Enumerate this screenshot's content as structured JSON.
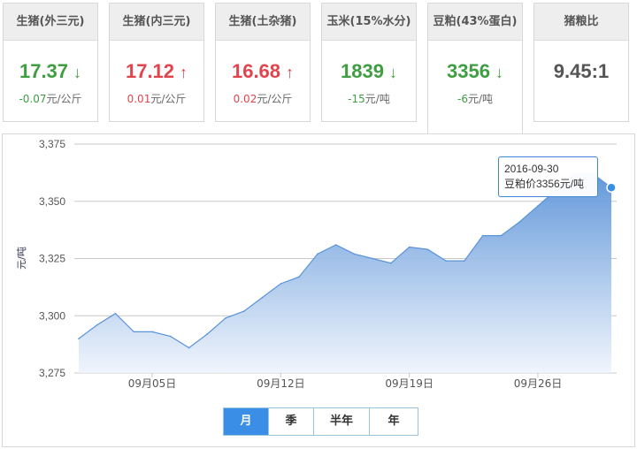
{
  "cards": [
    {
      "title": "生猪(外三元)",
      "price": "17.37",
      "arrow": "↓",
      "trend": "down",
      "change": "-0.07",
      "unit": "元/公斤"
    },
    {
      "title": "生猪(内三元)",
      "price": "17.12",
      "arrow": "↑",
      "trend": "up",
      "change": "0.01",
      "unit": "元/公斤"
    },
    {
      "title": "生猪(土杂猪)",
      "price": "16.68",
      "arrow": "↑",
      "trend": "up",
      "change": "0.02",
      "unit": "元/公斤"
    },
    {
      "title": "玉米(15%水分)",
      "price": "1839",
      "arrow": "↓",
      "trend": "down",
      "change": "-15",
      "unit": "元/吨"
    },
    {
      "title": "豆粕(43%蛋白)",
      "price": "3356",
      "arrow": "↓",
      "trend": "down",
      "change": "-6",
      "unit": "元/吨"
    },
    {
      "title": "猪粮比",
      "price": "9.45:1"
    }
  ],
  "active_card": "豆粕(43%蛋白)",
  "tabs": [
    "月",
    "季",
    "半年",
    "年"
  ],
  "active_tab": "月",
  "tooltip": {
    "date": "2016-09-30",
    "label": "豆粕价3356元/吨"
  },
  "colors": {
    "line": "#5b93d8",
    "area_top": "#5b93d8",
    "area_bottom": "#eef4fc",
    "point": "#3a8ee6",
    "grid": "#c8c8c8",
    "down": "#3f9d42",
    "up": "#e1444d"
  },
  "chart_data": {
    "type": "area",
    "ylabel": "元/吨",
    "ylim": [
      3275,
      3375
    ],
    "yticks": [
      "3,275",
      "3,300",
      "3,325",
      "3,350",
      "3,375"
    ],
    "yticks_values": [
      3275,
      3300,
      3325,
      3350,
      3375
    ],
    "xlim": [
      "2016-09-01",
      "2016-09-30"
    ],
    "xticks": [
      "09月05日",
      "09月12日",
      "09月19日",
      "09月26日"
    ],
    "xticks_dates": [
      "2016-09-05",
      "2016-09-12",
      "2016-09-19",
      "2016-09-26"
    ],
    "grid": true,
    "legend": false,
    "series": [
      {
        "points": [
          {
            "x": "2016-09-01",
            "y": 3290
          },
          {
            "x": "2016-09-02",
            "y": 3296
          },
          {
            "x": "2016-09-03",
            "y": 3301
          },
          {
            "x": "2016-09-04",
            "y": 3293
          },
          {
            "x": "2016-09-05",
            "y": 3293
          },
          {
            "x": "2016-09-06",
            "y": 3291
          },
          {
            "x": "2016-09-07",
            "y": 3286
          },
          {
            "x": "2016-09-08",
            "y": 3292
          },
          {
            "x": "2016-09-09",
            "y": 3299
          },
          {
            "x": "2016-09-10",
            "y": 3302
          },
          {
            "x": "2016-09-11",
            "y": 3308
          },
          {
            "x": "2016-09-12",
            "y": 3314
          },
          {
            "x": "2016-09-13",
            "y": 3317
          },
          {
            "x": "2016-09-14",
            "y": 3327
          },
          {
            "x": "2016-09-15",
            "y": 3331
          },
          {
            "x": "2016-09-16",
            "y": 3327
          },
          {
            "x": "2016-09-17",
            "y": 3325
          },
          {
            "x": "2016-09-18",
            "y": 3323
          },
          {
            "x": "2016-09-19",
            "y": 3330
          },
          {
            "x": "2016-09-20",
            "y": 3329
          },
          {
            "x": "2016-09-21",
            "y": 3324
          },
          {
            "x": "2016-09-22",
            "y": 3324
          },
          {
            "x": "2016-09-23",
            "y": 3335
          },
          {
            "x": "2016-09-24",
            "y": 3335
          },
          {
            "x": "2016-09-25",
            "y": 3341
          },
          {
            "x": "2016-09-26",
            "y": 3348
          },
          {
            "x": "2016-09-27",
            "y": 3355
          },
          {
            "x": "2016-09-28",
            "y": 3362
          },
          {
            "x": "2016-09-29",
            "y": 3362
          },
          {
            "x": "2016-09-30",
            "y": 3356
          }
        ]
      }
    ]
  }
}
